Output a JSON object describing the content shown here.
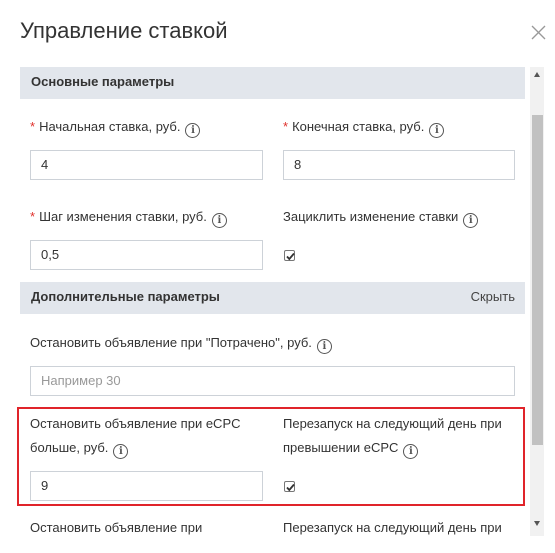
{
  "dialog": {
    "title": "Управление ставкой",
    "close_icon": "close-icon"
  },
  "main_section": {
    "title": "Основные параметры",
    "start_bid": {
      "label": "Начальная ставка, руб.",
      "required": true,
      "value": "4"
    },
    "end_bid": {
      "label": "Конечная ставка, руб.",
      "required": true,
      "value": "8"
    },
    "step": {
      "label": "Шаг изменения ставки, руб.",
      "required": true,
      "value": "0,5"
    },
    "cycle": {
      "label": "Зациклить изменение ставки",
      "checked": true
    }
  },
  "extra_section": {
    "title": "Дополнительные параметры",
    "hide_label": "Скрыть",
    "stop_spent": {
      "label": "Остановить объявление при \"Потрачено\", руб.",
      "placeholder": "Например 30",
      "value": ""
    },
    "stop_ecpc": {
      "label_line1": "Остановить объявление при eCPC",
      "label_line2": "больше, руб.",
      "value": "9"
    },
    "restart_ecpc": {
      "label_line1": "Перезапуск на следующий день при",
      "label_line2": "превышении eCPC",
      "checked": true
    },
    "stop_next": {
      "label_line1": "Остановить объявление при"
    },
    "restart_next": {
      "label_line1": "Перезапуск на следующий день при"
    }
  },
  "required_mark": "*",
  "info_glyph": "i",
  "colors": {
    "required": "#e0302b",
    "highlight": "#e0242a",
    "section_bg": "#e2e6ec"
  }
}
